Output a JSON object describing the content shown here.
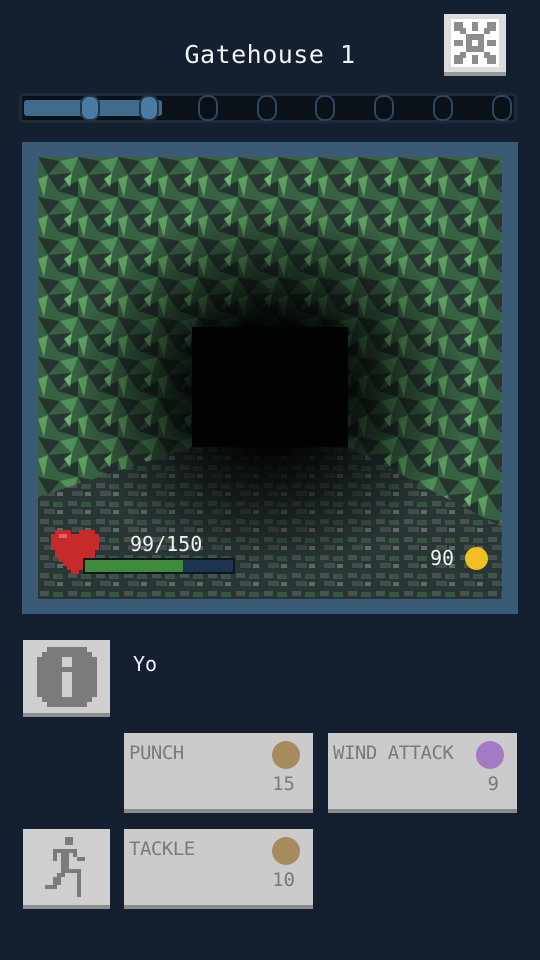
{
  "header": {
    "title": "Gatehouse 1"
  },
  "progress": {
    "total_nodes": 8,
    "completed_nodes": 2,
    "fill_fraction": 0.28
  },
  "player": {
    "hp_current": 99,
    "hp_max": 150,
    "hp_text": "99/150",
    "gold": "90"
  },
  "message": {
    "text": "Yo"
  },
  "skills": [
    {
      "name": "PUNCH",
      "cost": "15",
      "color": "#a58b5e"
    },
    {
      "name": "WIND ATTACK",
      "cost": "9",
      "color": "#a47ac3"
    },
    {
      "name": "TACKLE",
      "cost": "10",
      "color": "#a58b5e"
    }
  ],
  "icons": {
    "settings": "gear-icon",
    "info": "info-icon",
    "flee": "running-figure-icon",
    "heart": "heart-icon",
    "coin": "coin-icon"
  },
  "colors": {
    "background": "#14202f",
    "hp_bar": "#3f8a3b",
    "coin": "#f0c022",
    "progress": "#4a7ba2"
  }
}
